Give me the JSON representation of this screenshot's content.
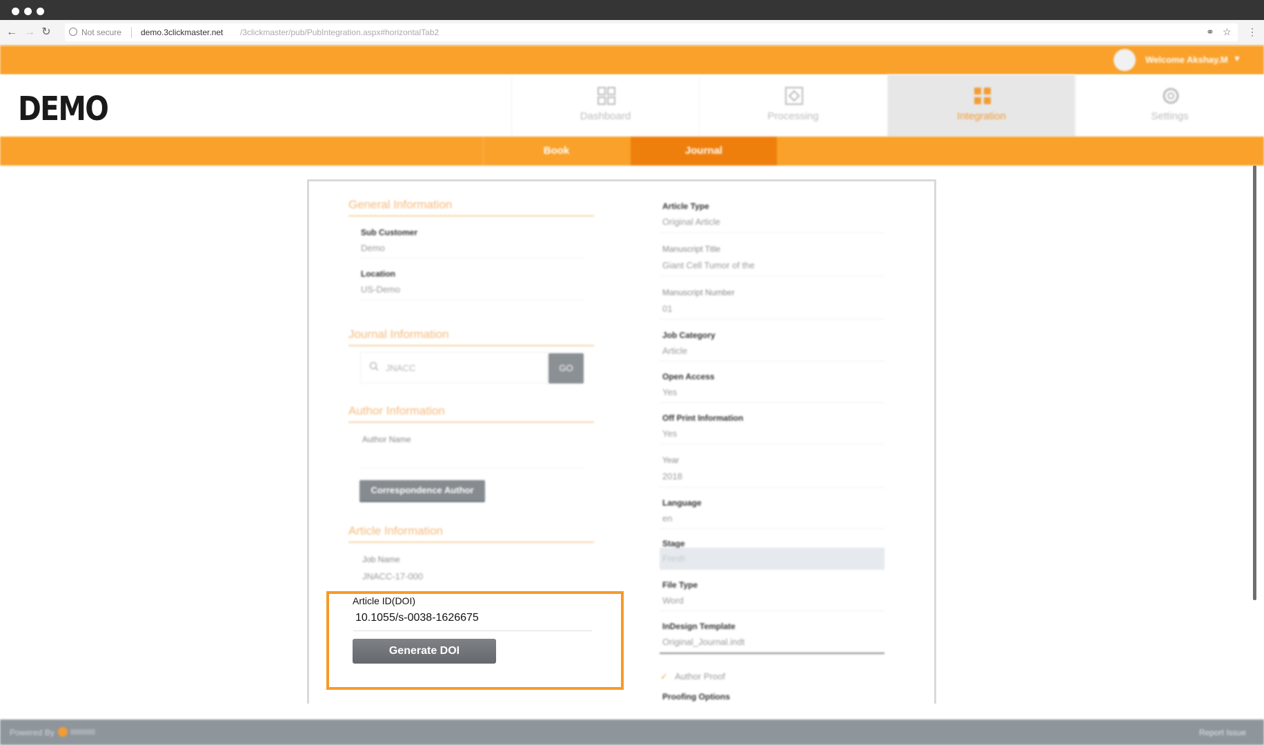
{
  "browser": {
    "security_label": "Not secure",
    "url_host": "demo.3clickmaster.net",
    "url_path": "/3clickmaster/pub/PubIntegration.aspx#horizontalTab2"
  },
  "userbar": {
    "welcome_text": "Welcome Akshay.M",
    "caret": "▼"
  },
  "header": {
    "logo_text": "DEMO",
    "nav": [
      {
        "label": "Dashboard",
        "icon": "dashboard-icon"
      },
      {
        "label": "Processing",
        "icon": "processing-icon"
      },
      {
        "label": "Integration",
        "icon": "integration-icon"
      },
      {
        "label": "Settings",
        "icon": "settings-icon"
      }
    ]
  },
  "subtabs": {
    "book": "Book",
    "journal": "Journal"
  },
  "left": {
    "general": {
      "title": "General Information",
      "sub_customer_label": "Sub Customer",
      "sub_customer_value": "Demo",
      "location_label": "Location",
      "location_value": "US-Demo"
    },
    "journal": {
      "title": "Journal Information",
      "search_value": "JNACC",
      "go_label": "GO"
    },
    "author": {
      "title": "Author Information",
      "author_name_label": "Author Name",
      "correspondence_button": "Correspondence Author"
    },
    "article": {
      "title": "Article Information",
      "job_name_label": "Job Name",
      "job_name_value": "JNACC-17-000",
      "doi_label": "Article ID(DOI)",
      "doi_value": "10.1055/s-0038-1626675",
      "generate_button": "Generate DOI"
    }
  },
  "right": {
    "fields": [
      {
        "label": "Article Type",
        "value": "Original Article"
      },
      {
        "label": "Manuscript Title",
        "value": "Giant Cell Tumor of the"
      },
      {
        "label": "Manuscript Number",
        "value": "01"
      },
      {
        "label": "Job Category",
        "value": "Article"
      },
      {
        "label": "Open Access",
        "value": "Yes"
      },
      {
        "label": "Off Print Information",
        "value": "Yes"
      },
      {
        "label": "Year",
        "value": "2018"
      },
      {
        "label": "Language",
        "value": "en"
      },
      {
        "label": "Stage",
        "value": "Fresh"
      },
      {
        "label": "File Type",
        "value": "Word"
      },
      {
        "label": "InDesign Template",
        "value": "Original_Journal.indt"
      }
    ],
    "author_proof_label": "Author Proof",
    "proofing_options_label": "Proofing Options"
  },
  "footer": {
    "powered_by": "Powered By",
    "report_issue": "Report Issue"
  },
  "colors": {
    "brand_orange": "#f9a12a",
    "active_orange": "#ef7f0c",
    "highlight_orange": "#f79a28",
    "button_gray": "#868b90"
  }
}
